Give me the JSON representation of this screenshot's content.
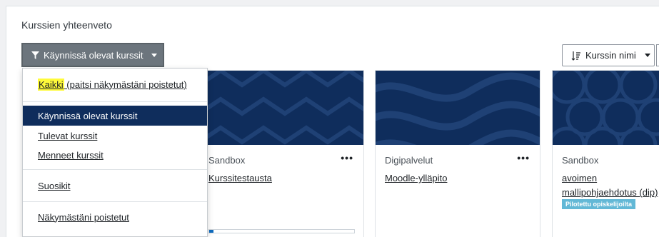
{
  "page": {
    "title": "Kurssien yhteenveto"
  },
  "toolbar": {
    "filter_label": "Käynnissä olevat kurssit",
    "sort_label": "Kurssin nimi"
  },
  "dropdown": {
    "items": [
      {
        "label_highlight": "Kaikki",
        "label_rest": " (paitsi näkymästäni poistetut)"
      },
      {
        "label": "Käynnissä olevat kurssit"
      },
      {
        "label": "Tulevat kurssit"
      },
      {
        "label": "Menneet kurssit"
      },
      {
        "label": "Suosikit"
      },
      {
        "label": "Näkymästäni poistetut"
      }
    ]
  },
  "cards": [
    {
      "category": "Sandbox",
      "name": "Kurssitestausta",
      "progress": 3
    },
    {
      "category": "Digipalvelut",
      "name": "Moodle-ylläpito",
      "progress": 0
    },
    {
      "category": "Sandbox",
      "name": "avoimen mallipohjaehdotus (dip)",
      "badge": "Pilotettu opiskelijoilta",
      "progress": 0
    }
  ],
  "colors": {
    "accent": "#0f2d5c",
    "badge": "#62b8d6",
    "highlight": "#fffb3a"
  }
}
